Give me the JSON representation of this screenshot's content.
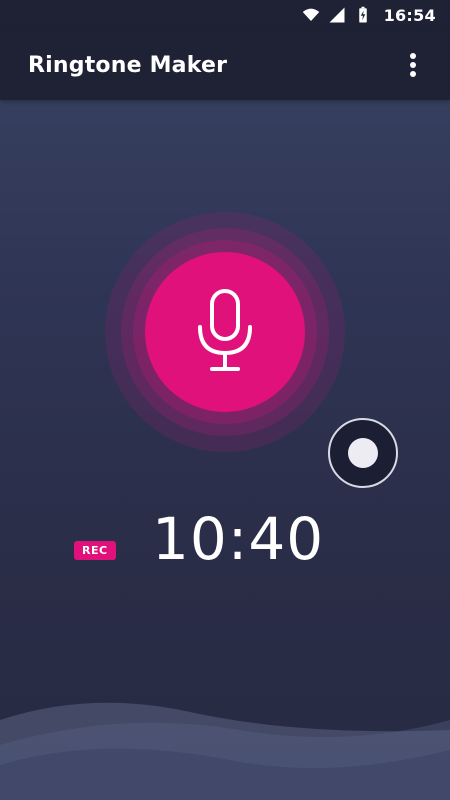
{
  "status_bar": {
    "time": "16:54",
    "icons": [
      "wifi-icon",
      "cellular-signal-icon",
      "battery-charging-icon"
    ]
  },
  "app_bar": {
    "title": "Ringtone Maker",
    "menu_icon": "more-vert-icon"
  },
  "recorder": {
    "mic_icon": "microphone-icon",
    "record_toggle_icon": "record-dot-icon",
    "rec_badge": "REC",
    "timer": "10:40"
  },
  "colors": {
    "accent": "#e0117a",
    "appbar_bg": "#1f2235",
    "background_top": "#3a4464",
    "background_bottom": "#272a42"
  }
}
